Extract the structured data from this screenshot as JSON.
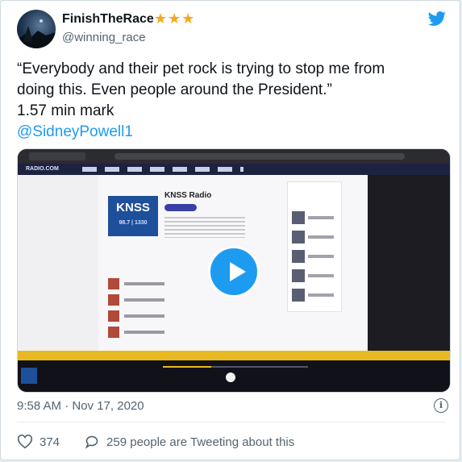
{
  "author": {
    "name": "FinishTheRace",
    "stars": "★★★",
    "handle": "@winning_race"
  },
  "tweet": {
    "line1": "“Everybody and their pet rock is trying to stop me from",
    "line2": "doing this. Even people around the President.”",
    "line3": "1.57 min mark",
    "mention": "@SidneyPowell1"
  },
  "media": {
    "station_logo": "KNSS",
    "station_logo_sub": "98.7 | 1330",
    "station_name": "KNSS Radio",
    "site_logo": "RADIO.COM"
  },
  "meta": {
    "timestamp": "9:58 AM · Nov 17, 2020",
    "likes": "374",
    "tweeting": "259 people are Tweeting about this"
  },
  "colors": {
    "accent": "#1d9bf0",
    "stars": "#f4a91b",
    "station": "#1e4f9a"
  }
}
